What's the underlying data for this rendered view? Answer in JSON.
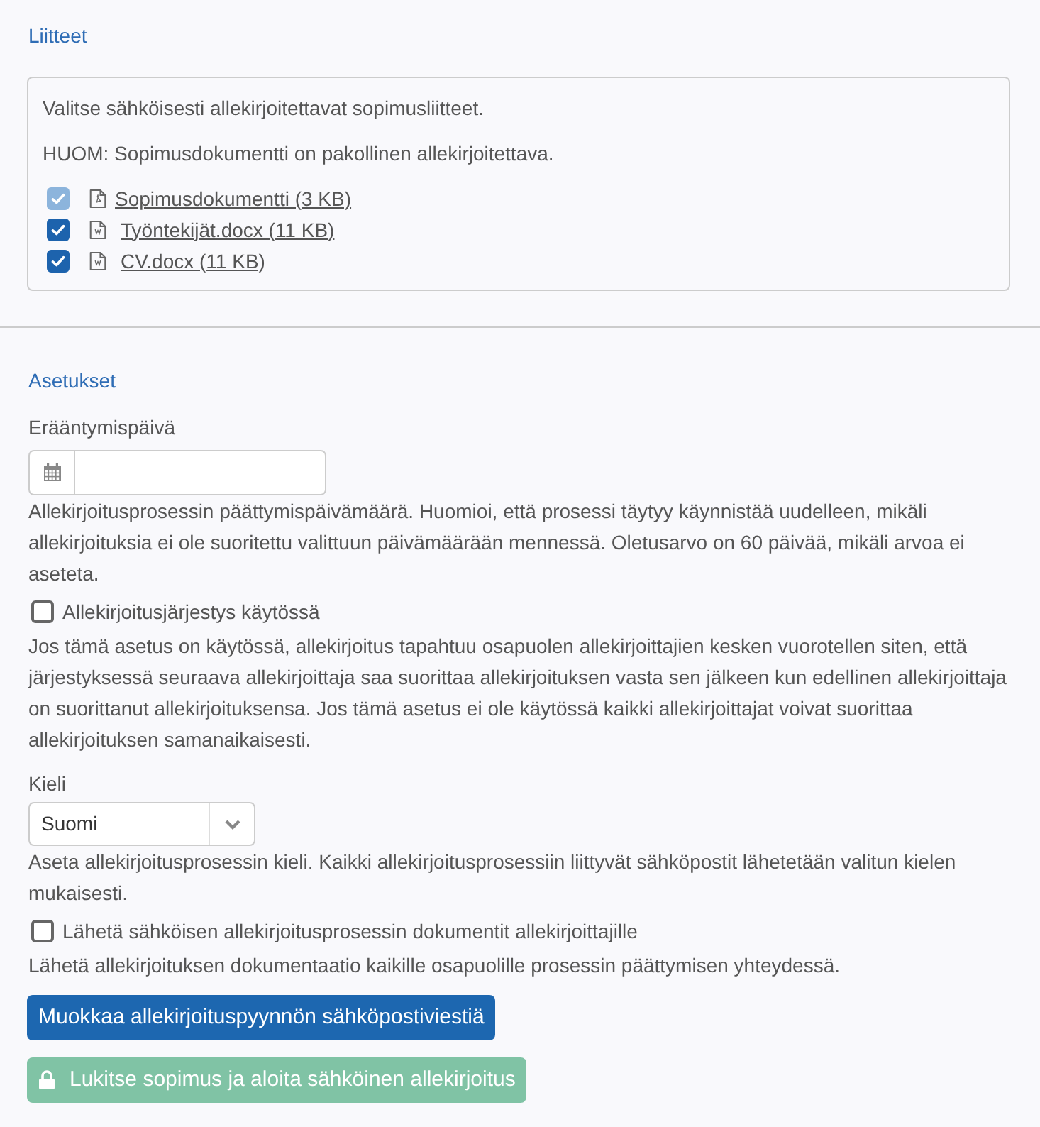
{
  "attachments": {
    "title": "Liitteet",
    "instructions": [
      "Valitse sähköisesti allekirjoitettavat sopimusliitteet.",
      "HUOM: Sopimusdokumentti on pakollinen allekirjoitettava."
    ],
    "files": [
      {
        "name": "Sopimusdokumentti (3 KB)",
        "kind": "pdf",
        "checked": true,
        "disabled": true
      },
      {
        "name": "Työntekijät.docx (11 KB)",
        "kind": "docx",
        "checked": true,
        "disabled": false
      },
      {
        "name": "CV.docx (11 KB)",
        "kind": "docx",
        "checked": true,
        "disabled": false
      }
    ]
  },
  "settings": {
    "title": "Asetukset",
    "items": [
      {
        "kind": "date",
        "label": "Erääntymispäivä",
        "help": "Allekirjoitusprosessin päättymispäivämäärä. Huomioi, että prosessi täytyy käynnistää uudelleen, mikäli allekirjoituksia ei ole suoritettu valittuun päivämäärään mennessä. Oletusarvo on 60 päivää, mikäli arvoa ei aseteta."
      },
      {
        "kind": "checkbox",
        "label": "Allekirjoitusjärjestys käytössä",
        "checked": false,
        "help": "Jos tämä asetus on käytössä, allekirjoitus tapahtuu osapuolen allekirjoittajien kesken vuorotellen siten, että järjestyksessä seuraava allekirjoittaja saa suorittaa allekirjoituksen vasta sen jälkeen kun edellinen allekirjoittaja on suorittanut allekirjoituksensa. Jos tämä asetus ei ole käytössä kaikki allekirjoittajat voivat suorittaa allekirjoituksen samanaikaisesti."
      },
      {
        "kind": "select",
        "label": "Kieli",
        "value": "Suomi",
        "help": "Aseta allekirjoitusprosessin kieli. Kaikki allekirjoitusprosessiin liittyvät sähköpostit lähetetään valitun kielen mukaisesti."
      },
      {
        "kind": "checkbox",
        "label": "Lähetä sähköisen allekirjoitusprosessin dokumentit allekirjoittajille",
        "checked": false,
        "help": "Lähetä allekirjoituksen dokumentaatio kaikille osapuolille prosessin päättymisen yhteydessä."
      }
    ]
  },
  "actions": [
    {
      "label": "Muokkaa allekirjoituspyynnön sähköpostiviestiä",
      "kind": "primary",
      "disabled": false
    },
    {
      "label": "Lukitse sopimus ja aloita sähköinen allekirjoitus",
      "kind": "lock",
      "disabled": true
    }
  ]
}
